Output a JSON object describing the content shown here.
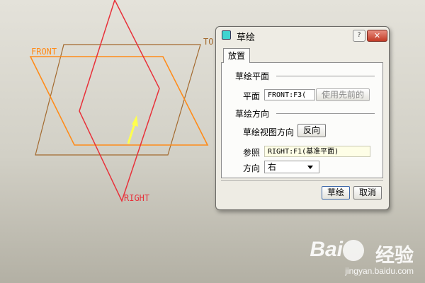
{
  "viewport": {
    "planes": [
      {
        "label": "FRONT",
        "color": "#ff8c1a"
      },
      {
        "label": "TO",
        "color": "#a36a2f"
      },
      {
        "label": "RIGHT",
        "color": "#e8313a"
      }
    ],
    "arrow_color": "#ffff4d"
  },
  "dialog": {
    "title": "草绘",
    "help_label": "?",
    "close_label": "✕",
    "tab": "放置",
    "sketch_plane": {
      "section": "草绘平面",
      "plane_label": "平面",
      "plane_value": "FRONT:F3(",
      "use_previous_label": "使用先前的"
    },
    "sketch_orientation": {
      "section": "草绘方向",
      "view_direction_label": "草绘视图方向",
      "flip_label": "反向",
      "reference_label": "参照",
      "reference_value": "RIGHT:F1(基准平面)",
      "direction_label": "方向",
      "direction_value": "右"
    },
    "ok_label": "草绘",
    "cancel_label": "取消"
  },
  "watermark": {
    "brand_prefix": "Bai",
    "brand_suffix": "经验",
    "url": "jingyan.baidu.com"
  },
  "colors": {
    "accent_titlebar": "#3fd4d0",
    "close_button": "#c23b26",
    "highlight_field": "#fefee6"
  }
}
